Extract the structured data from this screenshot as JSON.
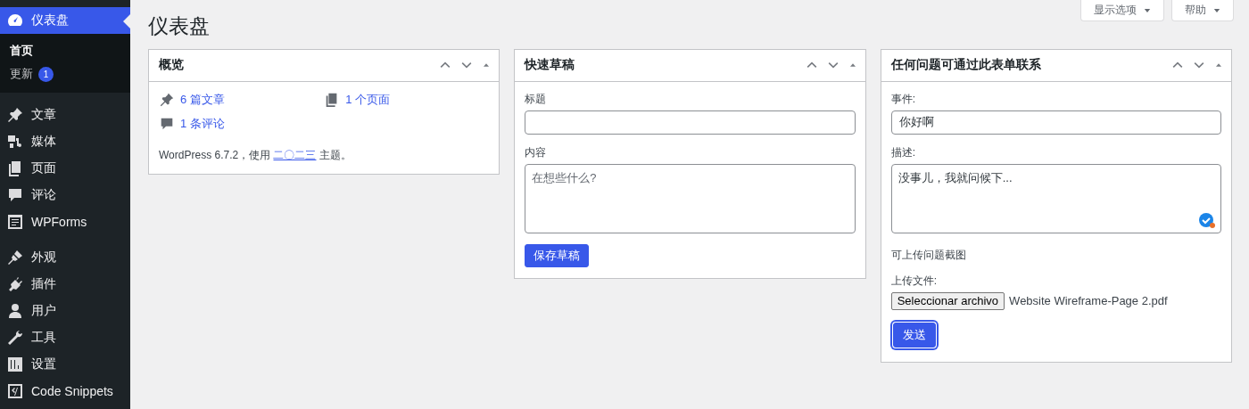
{
  "sidebar": {
    "groups": [
      [
        {
          "label": "仪表盘",
          "selected": true,
          "children": [
            {
              "label": "首页",
              "selected": true
            },
            {
              "label": "更新",
              "badge": "1",
              "selected": false
            }
          ]
        }
      ],
      [
        {
          "label": "文章",
          "selected": false
        },
        {
          "label": "媒体",
          "selected": false
        },
        {
          "label": "页面",
          "selected": false
        },
        {
          "label": "评论",
          "selected": false
        },
        {
          "label": "WPForms",
          "selected": false
        }
      ],
      [
        {
          "label": "外观",
          "selected": false
        },
        {
          "label": "插件",
          "selected": false
        },
        {
          "label": "用户",
          "selected": false
        },
        {
          "label": "工具",
          "selected": false
        },
        {
          "label": "设置",
          "selected": false
        },
        {
          "label": "Code Snippets",
          "selected": false
        }
      ]
    ]
  },
  "screen_meta": [
    {
      "label": "显示选项",
      "expanded": false
    },
    {
      "label": "帮助",
      "expanded": false
    }
  ],
  "page_title": "仪表盘",
  "widgets": [
    {
      "kind": "overview",
      "title": "概览",
      "stats": [
        {
          "label": "6 篇文章"
        },
        {
          "label": "1 个页面"
        },
        {
          "label": "1 条评论"
        }
      ],
      "footer": {
        "before": "WordPress 6.7.2，使用 ",
        "link": "二〇二三",
        "after": " 主题。"
      }
    },
    {
      "kind": "draft",
      "title": "快速草稿",
      "fields": [
        {
          "kind": "input",
          "label": "标题"
        },
        {
          "kind": "textarea",
          "label": "内容",
          "placeholder": "在想些什么?"
        }
      ],
      "button": "保存草稿"
    },
    {
      "kind": "form",
      "title": "任何问题可通过此表单联系",
      "fields": [
        {
          "kind": "input",
          "label": "事件:",
          "value": "你好啊"
        },
        {
          "kind": "textarea",
          "label": "描述:",
          "value": "没事儿，我就问候下..."
        },
        {
          "kind": "note",
          "label": "可上传问题截图"
        },
        {
          "kind": "file",
          "label": "上传文件:",
          "button": "Seleccionar archivo",
          "value": "Website Wireframe-Page 2.pdf"
        }
      ],
      "button": "发送",
      "button_focused": true
    }
  ]
}
